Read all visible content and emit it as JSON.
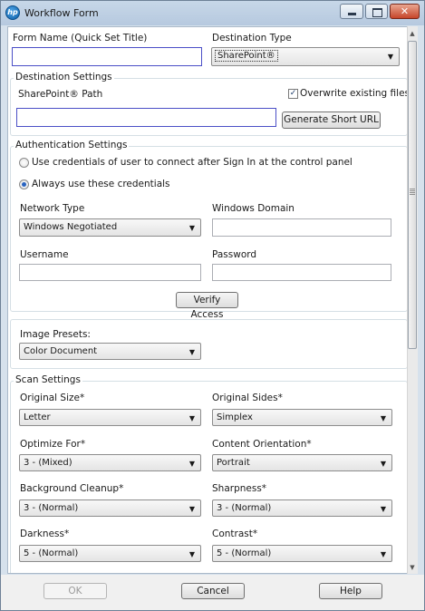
{
  "window": {
    "title": "Workflow Form",
    "logo_text": "hp",
    "close_glyph": "✕"
  },
  "form": {
    "form_name_label": "Form Name (Quick Set Title)",
    "form_name_value": "",
    "destination_type_label": "Destination Type",
    "destination_type_value": "SharePoint®"
  },
  "destination_settings": {
    "legend": "Destination Settings",
    "path_label": "SharePoint® Path",
    "path_value": "",
    "overwrite_label": "Overwrite existing files",
    "overwrite_checked": true,
    "check_glyph": "✓",
    "short_url_button": "Generate Short URL"
  },
  "authentication": {
    "legend": "Authentication Settings",
    "option_signin": "Use credentials of user to connect after Sign In at the control panel",
    "option_always": "Always use these credentials",
    "selected": "always",
    "network_type_label": "Network Type",
    "network_type_value": "Windows Negotiated",
    "windows_domain_label": "Windows Domain",
    "windows_domain_value": "",
    "username_label": "Username",
    "username_value": "",
    "password_label": "Password",
    "password_value": "",
    "verify_button": "Verify Access"
  },
  "image_presets": {
    "label": "Image Presets:",
    "value": "Color Document"
  },
  "scan_settings": {
    "legend": "Scan Settings",
    "original_size_label": "Original Size*",
    "original_size_value": "Letter",
    "original_sides_label": "Original Sides*",
    "original_sides_value": "Simplex",
    "optimize_for_label": "Optimize For*",
    "optimize_for_value": "3 - (Mixed)",
    "content_orientation_label": "Content Orientation*",
    "content_orientation_value": "Portrait",
    "background_cleanup_label": "Background Cleanup*",
    "background_cleanup_value": "3 - (Normal)",
    "sharpness_label": "Sharpness*",
    "sharpness_value": "3 - (Normal)",
    "darkness_label": "Darkness*",
    "darkness_value": "5 - (Normal)",
    "contrast_label": "Contrast*",
    "contrast_value": "5 - (Normal)"
  },
  "footer": {
    "ok_button": "OK",
    "cancel_button": "Cancel",
    "help_button": "Help"
  },
  "glyphs": {
    "dropdown_arrow": "▼",
    "scroll_up": "▲",
    "scroll_down": "▼"
  },
  "colors": {
    "focus_border": "#4b4fc7",
    "titlebar": "#c7d7e8",
    "close_button": "#c6452a"
  }
}
